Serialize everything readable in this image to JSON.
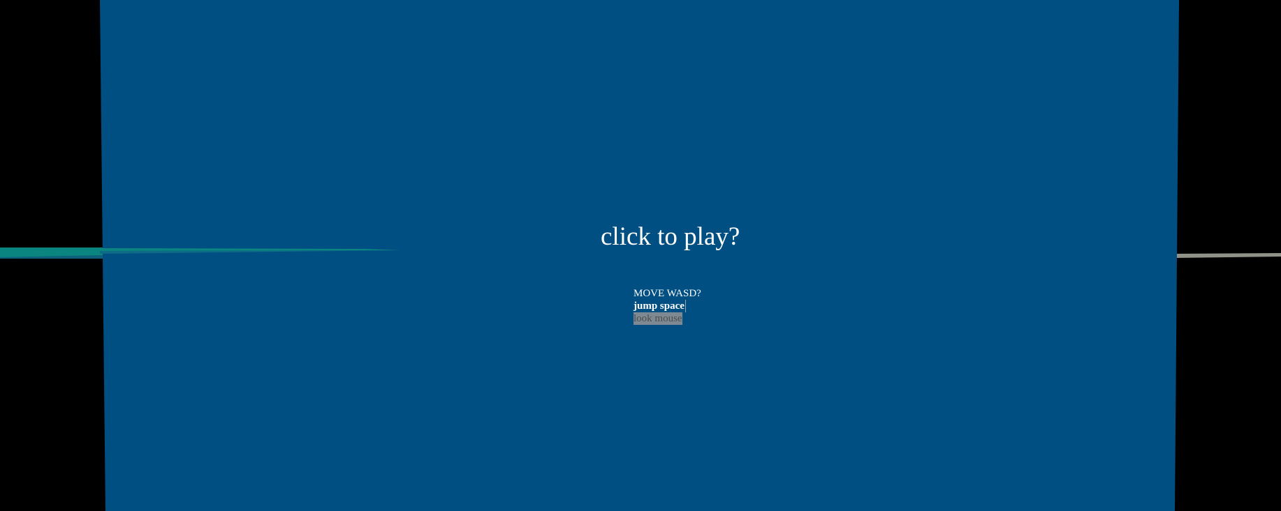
{
  "overlay": {
    "title": "click to play?",
    "controls": {
      "move": "MOVE WASD?",
      "jump": "jump space",
      "look": "look mouse"
    }
  },
  "colors": {
    "background": "#000000",
    "panel": "#004f82",
    "floor_stripe_teal": "#0a8580",
    "floor_stripe_grey": "#8f9287",
    "text": "#ffffff",
    "selection": "#7e8a93"
  }
}
